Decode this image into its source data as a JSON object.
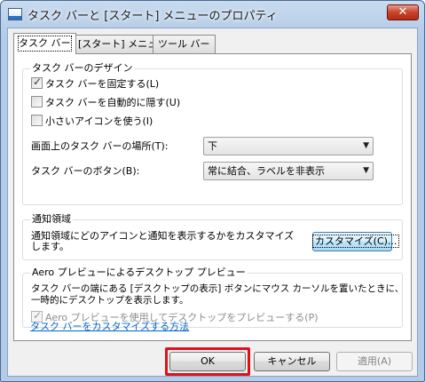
{
  "window": {
    "title": "タスク バーと [スタート] メニューのプロパティ",
    "close_glyph": "✕"
  },
  "tabs": [
    {
      "label": "タスク バー",
      "active": true
    },
    {
      "label": "[スタート] メニュー",
      "active": false
    },
    {
      "label": "ツール バー",
      "active": false
    }
  ],
  "taskbar_design": {
    "title": "タスク バーのデザイン",
    "lock_taskbar": {
      "label": "タスク バーを固定する(L)",
      "checked": true
    },
    "auto_hide": {
      "label": "タスク バーを自動的に隠す(U)",
      "checked": false
    },
    "small_icons": {
      "label": "小さいアイコンを使う(I)",
      "checked": false
    },
    "location_label": "画面上のタスク バーの場所(T):",
    "location_value": "下",
    "buttons_label": "タスク バーのボタン(B):",
    "buttons_value": "常に結合、ラベルを非表示"
  },
  "notification_area": {
    "title": "通知領域",
    "description": "通知領域にどのアイコンと通知を表示するかをカスタマイズします。",
    "customize_button": "カスタマイズ(C)..."
  },
  "aero_peek": {
    "title": "Aero プレビューによるデスクトップ プレビュー",
    "description_line1": "タスク バーの端にある [デスクトップの表示] ボタンにマウス カーソルを置いたときに、",
    "description_line2": "一時的にデスクトップを表示します。",
    "use_peek": {
      "label": "Aero プレビューを使用してデスクトップをプレビューする(P)",
      "checked": true,
      "disabled": true
    }
  },
  "help_link": "タスク バーをカスタマイズする方法",
  "footer": {
    "ok": "OK",
    "cancel": "キャンセル",
    "apply": "適用(A)"
  },
  "colors": {
    "highlight": "#e0101a",
    "link": "#0066cc"
  },
  "icons": {
    "window": "taskbar-properties-icon",
    "close": "close-icon",
    "dropdown": "chevron-down-icon",
    "checkbox": "checkmark-icon"
  }
}
